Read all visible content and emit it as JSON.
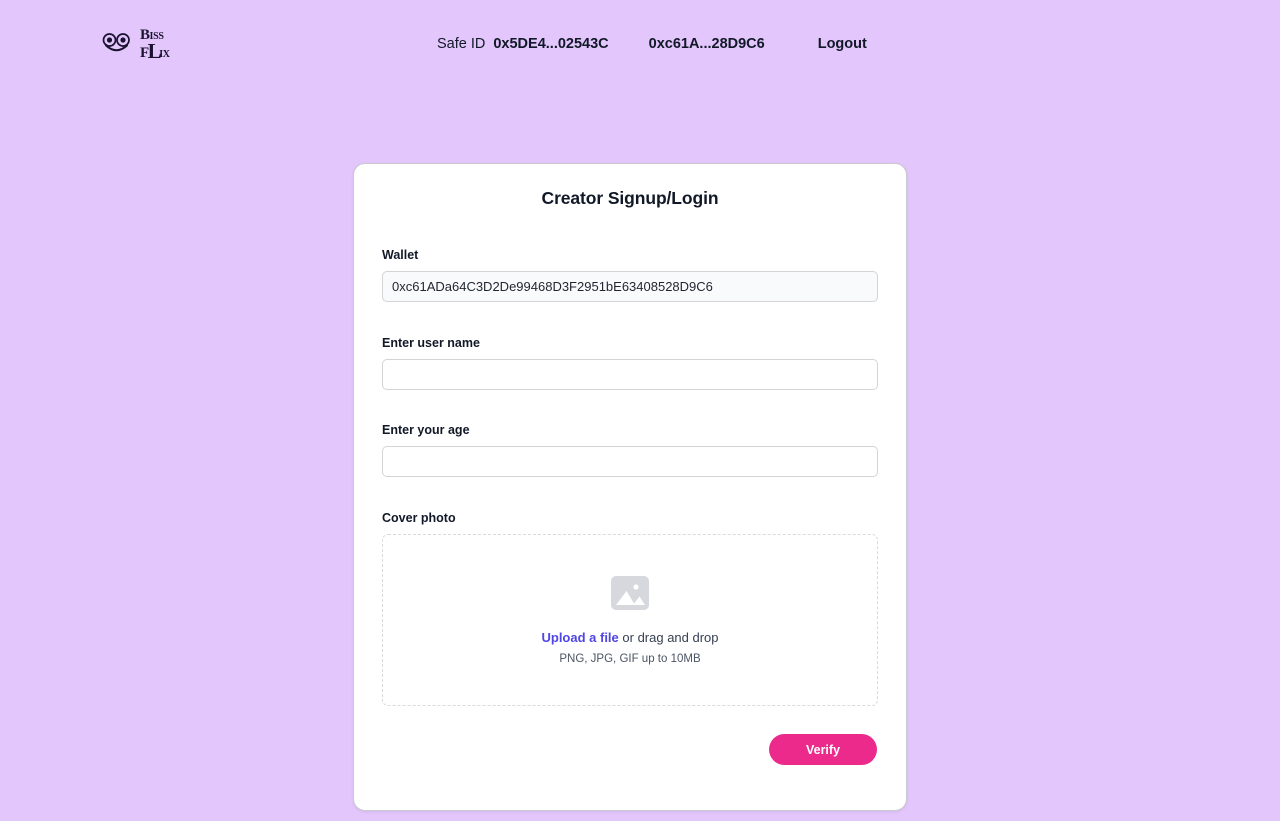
{
  "brand": {
    "name": "BLISSFLIX",
    "line1_first": "B",
    "line1_rest": "ISS",
    "line2_first": "F",
    "line2_rest": "IX",
    "big_letter": "L",
    "face_icon": "smiley-face-icon"
  },
  "header": {
    "safe_id_label": "Safe ID",
    "safe_id_value": "0x5DE4...02543C",
    "wallet_short": "0xc61A...28D9C6",
    "logout_label": "Logout"
  },
  "card": {
    "title": "Creator Signup/Login",
    "fields": {
      "wallet": {
        "label": "Wallet",
        "value": "0xc61ADa64C3D2De99468D3F2951bE63408528D9C6",
        "placeholder": ""
      },
      "username": {
        "label": "Enter user name",
        "value": "",
        "placeholder": ""
      },
      "age": {
        "label": "Enter your age",
        "value": "",
        "placeholder": ""
      },
      "cover": {
        "label": "Cover photo",
        "icon": "photo-placeholder-icon",
        "upload_link": "Upload a file",
        "drag_text": " or drag and drop",
        "hint": "PNG, JPG, GIF up to 10MB"
      }
    },
    "verify_label": "Verify"
  },
  "colors": {
    "page_background": "#e3c6fc",
    "card_background": "#ffffff",
    "accent_pink": "#ec2a8b",
    "link_indigo": "#4f46e5",
    "readonly_field": "#f9fafb"
  }
}
